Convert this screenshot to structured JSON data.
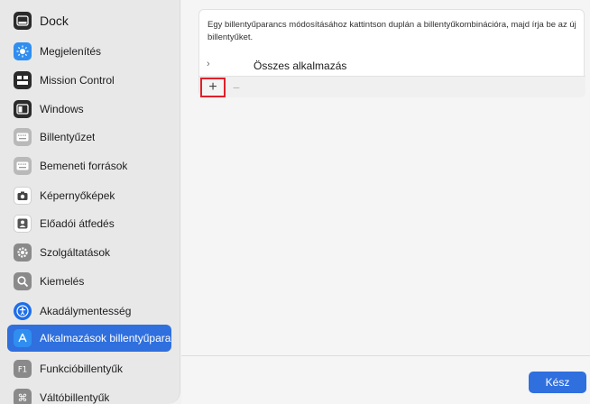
{
  "sidebar": {
    "items": [
      {
        "label": "Dock",
        "icon": "dock-icon",
        "color": "#2b2b2b"
      },
      {
        "label": "Megjelenítés",
        "icon": "display-icon",
        "color": "#2f8ef0"
      },
      {
        "label": "Mission Control",
        "icon": "mission-control-icon",
        "color": "#2b2b2b"
      },
      {
        "label": "Windows",
        "icon": "windows-icon",
        "color": "#2b2b2b"
      },
      {
        "label": "Billentyűzet",
        "icon": "keyboard-icon",
        "color": "#9a9a9a"
      },
      {
        "label": "Bemeneti források",
        "icon": "input-sources-icon",
        "color": "#9a9a9a"
      },
      {
        "label": "Képernyőképek",
        "icon": "screenshot-icon",
        "color": "#ffffff"
      },
      {
        "label": "Előadói átfedés",
        "icon": "presenter-overlay-icon",
        "color": "#ffffff"
      },
      {
        "label": "Szolgáltatások",
        "icon": "gear-icon",
        "color": "#8a8a8a"
      },
      {
        "label": "Kiemelés",
        "icon": "spotlight-icon",
        "color": "#8a8a8a"
      },
      {
        "label": "Akadálymentesség",
        "icon": "accessibility-icon",
        "color": "#1e6ee8"
      },
      {
        "label": "Alkalmazások billentyűparancsai",
        "icon": "app-store-icon",
        "color": "#2f8ef0"
      },
      {
        "label": "Funkcióbillentyűk",
        "icon": "function-keys-icon",
        "color": "#8a8a8a"
      },
      {
        "label": "Váltóbillentyűk",
        "icon": "command-icon",
        "color": "#8a8a8a"
      }
    ],
    "selected_index": 11
  },
  "main": {
    "description": "Egy billentyűparancs módosításához kattintson duplán a billentyűkombinációra, majd írja be az új billentyűket.",
    "all_apps_label": "Összes alkalmazás",
    "add_symbol": "+",
    "remove_symbol": "−",
    "chevron_symbol": "›"
  },
  "footer": {
    "done_label": "Kész"
  },
  "colors": {
    "accent": "#2f6fde",
    "highlight": "#e0202a"
  }
}
